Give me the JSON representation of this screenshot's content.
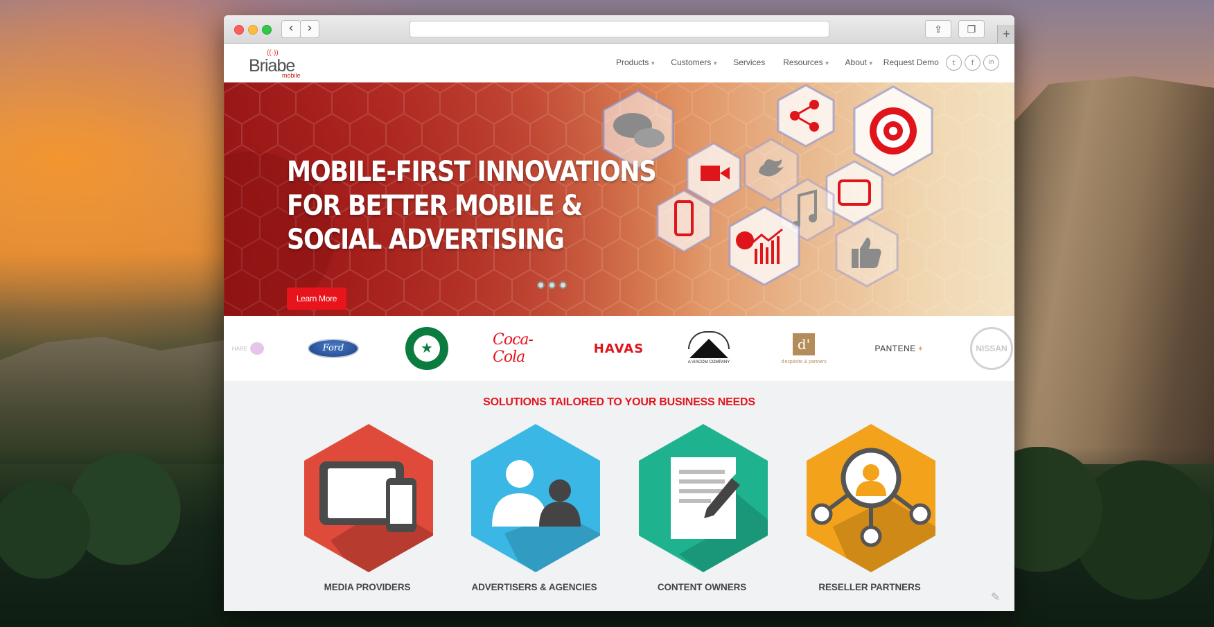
{
  "site": {
    "logo_text": "Briabe",
    "logo_sub": "mobile",
    "nav": [
      {
        "label": "Products",
        "dropdown": true
      },
      {
        "label": "Customers",
        "dropdown": true
      },
      {
        "label": "Services",
        "dropdown": false
      },
      {
        "label": "Resources",
        "dropdown": true
      },
      {
        "label": "About",
        "dropdown": true
      },
      {
        "label": "Request Demo",
        "dropdown": false
      }
    ],
    "social": [
      {
        "name": "twitter-icon",
        "glyph": "t"
      },
      {
        "name": "facebook-icon",
        "glyph": "f"
      },
      {
        "name": "linkedin-icon",
        "glyph": "in"
      }
    ]
  },
  "browser": {
    "back_glyph": "‹",
    "forward_glyph": "›",
    "url": "",
    "share_glyph": "⇪",
    "tabs_glyph": "❐",
    "newtab_glyph": "+"
  },
  "hero": {
    "title_lines": [
      "MOBILE-FIRST INNOVATIONS",
      "FOR BETTER MOBILE &",
      "SOCIAL ADVERTISING"
    ],
    "cta": "Learn More",
    "slides": 3,
    "active_slide": 0,
    "icons": [
      "chat-icon",
      "share-icon",
      "target-icon",
      "video-camera-icon",
      "twitter-icon",
      "tablet-icon",
      "music-icon",
      "smartphone-icon",
      "revenue-chart-icon",
      "thumbs-up-icon"
    ]
  },
  "brands": {
    "partial_left": "HARE",
    "ford": "Ford",
    "starbucks": "★",
    "cocacola": "Coca-Cola",
    "havas": "HAVAS",
    "paramount_name": "Paramount",
    "paramount_sub": "A VIACOM COMPANY",
    "dexposito_mark": "d'",
    "dexposito_text": "d'expósito & partners",
    "pantene": "PANTENE",
    "nissan": "NISSAN"
  },
  "solutions": {
    "title": "SOLUTIONS TAILORED TO YOUR BUSINESS NEEDS",
    "items": [
      {
        "label": "MEDIA PROVIDERS",
        "color": "#e04a3a",
        "icon": "devices-icon"
      },
      {
        "label": "ADVERTISERS & AGENCIES",
        "color": "#3ab7e4",
        "icon": "people-icon"
      },
      {
        "label": "CONTENT OWNERS",
        "color": "#1fb28f",
        "icon": "document-pen-icon"
      },
      {
        "label": "RESELLER PARTNERS",
        "color": "#f2a21b",
        "icon": "network-user-icon"
      }
    ]
  },
  "colors": {
    "brand_red": "#e3161d",
    "accent_red": "#e8141b"
  }
}
